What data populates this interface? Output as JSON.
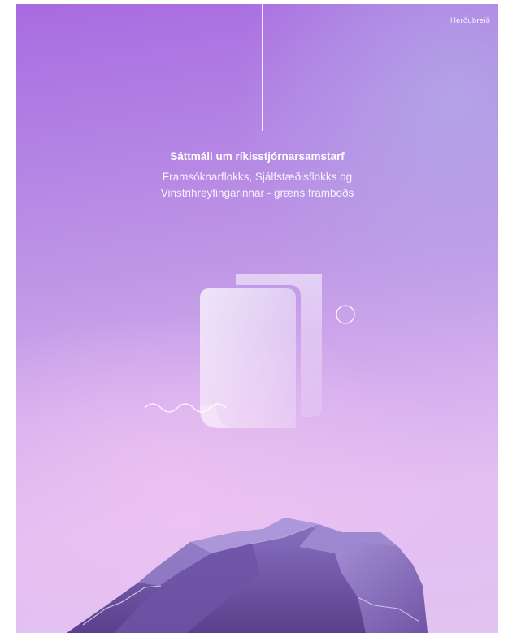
{
  "header": {
    "brand": "Herðubreið"
  },
  "cover": {
    "title": "Sáttmáli um ríkisstjórnarsamstarf",
    "subtitle_line1": "Framsóknarflokks, Sjálfstæðisflokks og",
    "subtitle_line2": "Vinstrihreyfingarinnar - græns framboðs"
  },
  "colors": {
    "background_top": "#a86be0",
    "background_bottom": "#e4bff2",
    "mountain_dark": "#5b3f8a",
    "mountain_light": "#9a84cc",
    "text": "#ffffff"
  },
  "icons": [
    "document-pages-illustration",
    "circle-icon",
    "wave-line-icon",
    "mountain-illustration"
  ]
}
